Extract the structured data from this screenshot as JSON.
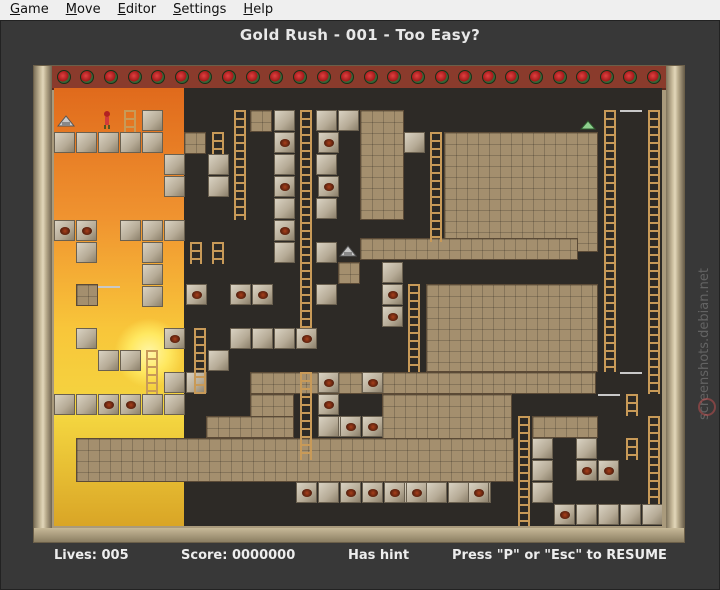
{
  "menu": [
    {
      "label": "Game",
      "mnemonic": "G",
      "rest": "ame"
    },
    {
      "label": "Move",
      "mnemonic": "M",
      "rest": "ove"
    },
    {
      "label": "Editor",
      "mnemonic": "E",
      "rest": "ditor"
    },
    {
      "label": "Settings",
      "mnemonic": "S",
      "rest": "ettings"
    },
    {
      "label": "Help",
      "mnemonic": "H",
      "rest": "elp"
    }
  ],
  "title": "Gold Rush - 001 - Too Easy?",
  "status": {
    "lives": "Lives: 005",
    "score": "Score: 0000000",
    "hint": "Has hint",
    "resume": "Press \"P\" or \"Esc\" to RESUME"
  },
  "watermark": "screenshots.debian.net",
  "colors": {
    "sky_top": "#e06a1c",
    "sky_bottom": "#f4d640",
    "brick": "#a48f6e",
    "ladder": "#c89a58",
    "text": "#ededed"
  },
  "icons": {
    "hero": "runner-icon",
    "enemy": "enemy-icon",
    "gold": "gold-pile-icon"
  }
}
